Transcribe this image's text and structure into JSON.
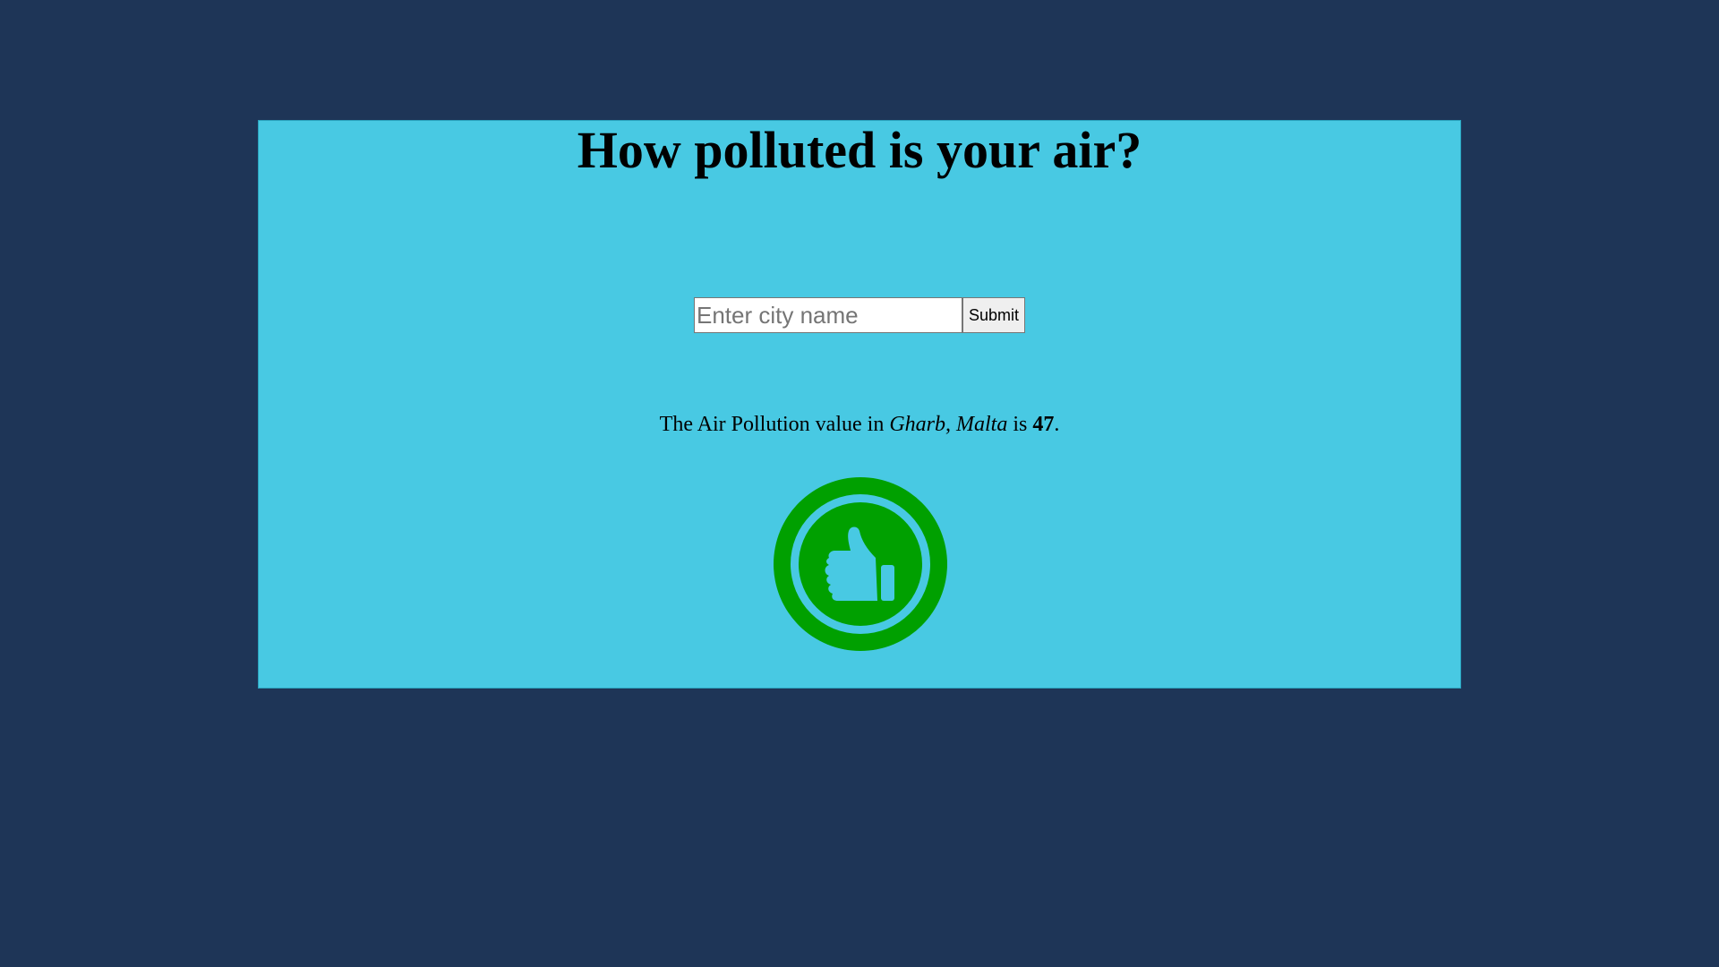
{
  "page": {
    "title": "How polluted is your air?"
  },
  "search": {
    "placeholder": "Enter city name",
    "value": "",
    "submit_label": "Submit"
  },
  "result": {
    "prefix": "The Air Pollution value in ",
    "city": "Gharb, Malta",
    "middle": " is ",
    "value": "47",
    "suffix": "."
  },
  "status_icon": {
    "name": "thumbs-up-icon",
    "color": "#00a000"
  },
  "colors": {
    "background": "#1e3557",
    "panel": "#48c9e3",
    "good": "#00a000"
  }
}
